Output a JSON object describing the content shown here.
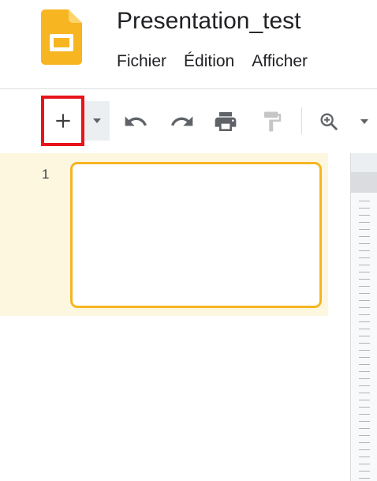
{
  "app": {
    "accent_color": "#f6b521"
  },
  "header": {
    "logo_icon": "google-slides-logo-icon",
    "title": "Presentation_test",
    "menu": [
      "Fichier",
      "Édition",
      "Afficher"
    ]
  },
  "toolbar": {
    "highlight_color": "#e8141a",
    "icons": {
      "add": "plus-icon",
      "add_dropdown": "caret-down-icon",
      "undo": "undo-icon",
      "redo": "redo-icon",
      "print": "print-icon",
      "paint_format": "paint-format-icon",
      "zoom": "zoom-in-icon",
      "zoom_dropdown": "caret-down-icon"
    }
  },
  "filmstrip": {
    "slides": [
      {
        "number": "1",
        "selected": true
      }
    ]
  }
}
